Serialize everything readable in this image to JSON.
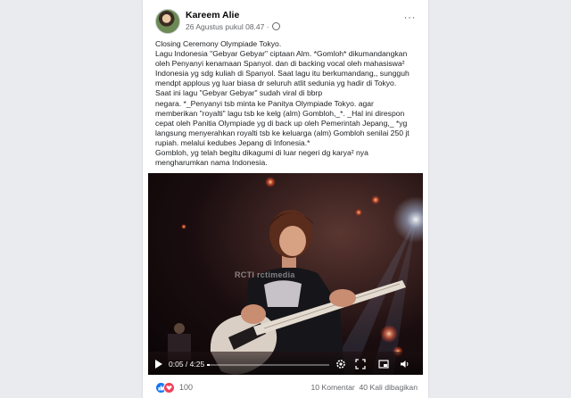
{
  "post": {
    "author": "Kareem Alie",
    "timestamp": "26 Agustus pukul 08.47",
    "separator": " · ",
    "more": "···",
    "lines": [
      "Closing Ceremony Olympiade Tokyo.",
      "Lagu Indonesia \"Gebyar Gebyar\" ciptaan Alm. *Gomloh* dikumandangkan",
      "oleh Penyanyi kenamaan Spanyol. dan di backing vocal oleh mahasiswa²",
      "Indonesia yg sdg kuliah di Spanyol. Saat lagu itu berkumandang,, sungguh",
      "mendpt applous yg luar biasa dr seluruh atlit sedunia yg hadir di Tokyo.",
      "Saat ini lagu \"Gebyar Gebyar\" sudah viral di bbrp",
      "negara. *_Penyanyi tsb minta ke Panitya Olympiade Tokyo. agar",
      "memberikan \"royalti\" lagu tsb ke kelg (alm) Gombloh,_*. _Hal ini direspon",
      "cepat oleh Panitia Olympiade yg di back up oleh Pemerintah Jepang,_ *yg",
      "langsung menyerahkan royalti tsb ke keluarga (alm) Gombloh senilai 250 jt",
      "rupiah. melalui kedubes Jepang di Infonesia.*",
      "Gombloh, yg telah begitu dikagumi di luar negeri dg karya² nya",
      "mengharumkan nama Indonesia."
    ]
  },
  "video": {
    "watermark": "RCTI  rctimedia",
    "current_time": "0:05",
    "duration": "4:25",
    "time_separator": " / ",
    "progress": 0.02
  },
  "footer": {
    "reaction_count": "100",
    "comments": "10 Komentar",
    "shares": "40 Kali dibagikan"
  },
  "colors": {
    "like": "#1877f2",
    "love": "#f33e58",
    "secondary_text": "#65676b"
  }
}
